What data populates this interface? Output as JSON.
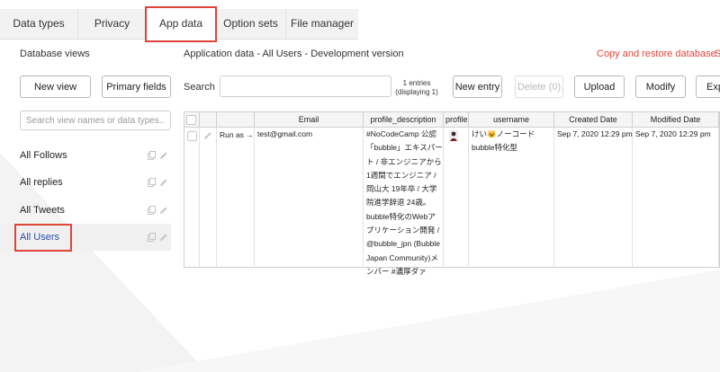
{
  "tabs": [
    {
      "label": "Data types"
    },
    {
      "label": "Privacy"
    },
    {
      "label": "App data"
    },
    {
      "label": "Option sets"
    },
    {
      "label": "File manager"
    }
  ],
  "left_panel": {
    "title": "Database views",
    "new_view_label": "New view",
    "primary_fields_label": "Primary fields",
    "search_placeholder": "Search view names or data types...",
    "views": [
      {
        "label": "All Follows"
      },
      {
        "label": "All replies"
      },
      {
        "label": "All Tweets"
      },
      {
        "label": "All Users",
        "selected": true
      }
    ]
  },
  "main": {
    "title": "Application data - All Users - Development version",
    "copy_restore_label": "Copy and restore database",
    "cut_label": "S",
    "search_label": "Search",
    "search_value": "",
    "entries_count": "1 entries",
    "entries_display": "(displaying 1)",
    "buttons": {
      "new_entry": "New entry",
      "delete": "Delete (0)",
      "upload": "Upload",
      "modify": "Modify",
      "export_cut": "Exp"
    }
  },
  "table": {
    "columns": [
      "Email",
      "profile_description",
      "profile",
      "username",
      "Created Date",
      "Modified Date"
    ],
    "rows": [
      {
        "run_as": "Run as →",
        "email": "test@gmail.com",
        "profile_description_lines": [
          "#NoCodeCamp 公認",
          "「bubble」エキスパー",
          "ト / 非エンジニアから",
          "1週間でエンジニア /",
          "岡山大 19年卒 / 大学",
          "院進学辞退 24歳。",
          "bubble特化のWebア",
          "プリケーション開発 /",
          "@bubble_jpn (Bubble",
          "Japan Community)メ",
          "ンバー #濃厚ダァ"
        ],
        "username_lines": [
          "けい😺ノーコード",
          "bubble特化型"
        ],
        "created": "Sep 7, 2020 12:29 pm",
        "modified": "Sep 7, 2020 12:29 pm"
      }
    ]
  },
  "colors": {
    "accent_red": "#e0433a",
    "selected_text": "#2a4cb0",
    "tab_bg": "#f2f2f2"
  }
}
